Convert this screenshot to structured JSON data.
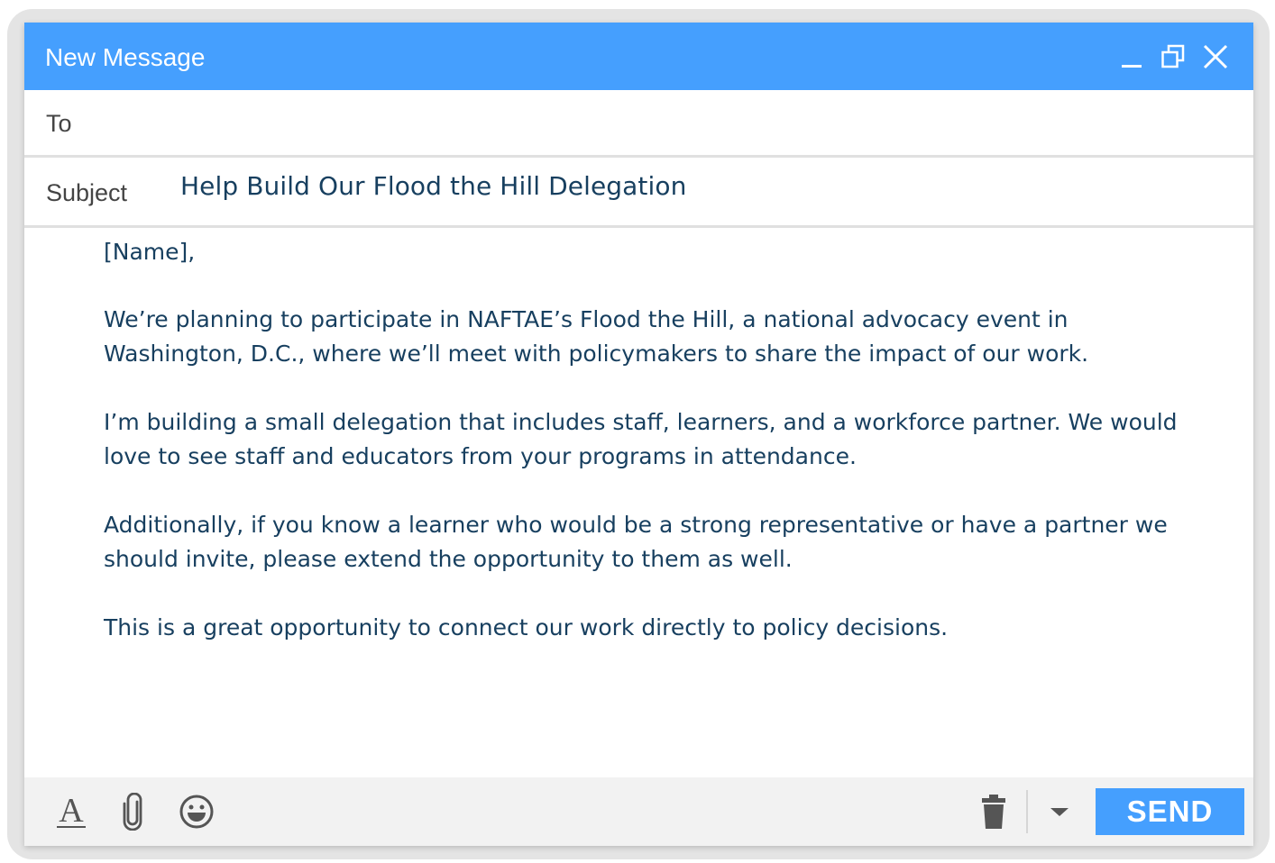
{
  "window": {
    "title": "New Message",
    "controls": [
      "minimize-icon",
      "restore-icon",
      "close-icon"
    ]
  },
  "fields": {
    "to_label": "To",
    "to_value": "",
    "subject_label": "Subject",
    "subject_value": "Help Build Our Flood the Hill Delegation"
  },
  "body": {
    "paragraphs": [
      "[Name],",
      "We’re planning to participate in NAFTAE’s Flood the Hill, a national advocacy event in Washington, D.C., where we’ll meet with policymakers to share the impact of our work.",
      "I’m building a small delegation that includes staff, learners, and a workforce partner. We would love to see staff and educators from your programs in attendance.",
      "Additionally, if you know a learner who would be a strong representative or have a partner we should invite, please extend the opportunity to them as well.",
      "This is a great opportunity to connect our work directly to policy decisions."
    ]
  },
  "toolbar": {
    "icons": [
      "text-format-icon",
      "paperclip-icon",
      "emoji-icon",
      "trash-icon",
      "caret-down-icon"
    ],
    "send_label": "SEND"
  },
  "colors": {
    "accent": "#459ffe",
    "text": "#173f5f",
    "toolbar_bg": "#f2f2f2"
  }
}
